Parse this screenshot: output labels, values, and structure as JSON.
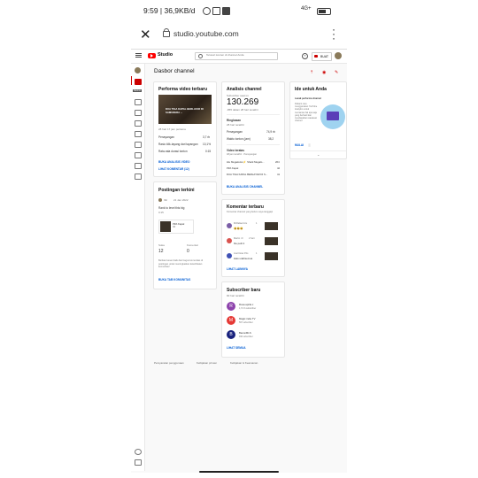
{
  "status_bar": {
    "time_data": "9:59 | 36,9KB/d",
    "signal": "4G+",
    "battery_label": "battery"
  },
  "browser": {
    "url": "studio.youtube.com"
  },
  "topbar": {
    "logo_text": "Studio",
    "search_placeholder": "Telusuri konten di channel Anda",
    "create_label": "BUAT",
    "help_glyph": "?"
  },
  "sidebar": {
    "tooltip": "Dasbor"
  },
  "page": {
    "title": "Dasbor channel"
  },
  "latest_video": {
    "title": "Performa video terbaru",
    "thumb_caption": "DUA TIGA KAPAL BERLAYAR DI SAMUDERA ...",
    "meta": "28 hari 17 jam pertama",
    "rows": [
      {
        "label": "Penayangan",
        "value": "3,7 rb"
      },
      {
        "label": "Rasio klik-tayang dari tayangan",
        "value": "10,1%"
      },
      {
        "label": "Rata-rata durasi tonton",
        "value": "0:15"
      }
    ],
    "link_analysis": "BUKA ANALISIS VIDEO",
    "link_comments": "LIHAT KOMENTAR (12)"
  },
  "latest_post": {
    "title": "Postingan terkini",
    "author": "Ibil",
    "date": "21 Jan 2022",
    "body": "Rank to level this big",
    "sub": "0:15",
    "embed_title": "Pilih Kapal",
    "embed_sub": "Ibil",
    "stats": [
      {
        "label": "Suka",
        "value": "12"
      },
      {
        "label": "Komentar",
        "value": "0"
      }
    ],
    "note": "Berikan kesan baik dan bagus komunitas di postingan untuk meningkatkan keterlibatan komunitas!",
    "link": "BUKA TAB KOMUNITAS"
  },
  "analytics": {
    "title": "Analisis channel",
    "sub_label": "Subscriber saat ini",
    "subscribers": "130.269",
    "sub_change": "-855 dalam 28 hari terakhir",
    "summary_title": "Ringkasan",
    "summary_sub": "28 hari terakhir",
    "summary_rows": [
      {
        "label": "Penayangan",
        "value": "74,9 rb"
      },
      {
        "label": "Waktu tonton (jam)",
        "value": "38,2"
      }
    ],
    "top_title": "Video teratas",
    "top_sub": "48 jam terakhir · Penayangan",
    "top_rows": [
      {
        "label": "Hiu Megalodon⚡ Shark Megalo...",
        "value": "264"
      },
      {
        "label": "Pilih Kapal",
        "value": "42"
      },
      {
        "label": "DUA TIGA KAPAL BERLAYAR DI S...",
        "value": "41"
      }
    ],
    "link": "BUKA ANALISIS CHANNEL"
  },
  "comments": {
    "title": "Komentar terbaru",
    "sub": "Komentar channel yang belum saya tanggapi",
    "items": [
      {
        "name": "MrRafael Aru",
        "time": "1",
        "text": "😆😆😆",
        "color": "#7b5ea7"
      },
      {
        "name": "Martin .D",
        "time": "2 hari",
        "text": "Ibu pelit 2",
        "color": "#d9534f"
      },
      {
        "name": "Joel Dewi Pris",
        "time": "1",
        "text": "Halo udahsemua",
        "color": "#3f51b5"
      }
    ],
    "link": "LIHAT LAINNYA"
  },
  "new_subs": {
    "title": "Subscriber baru",
    "sub": "90 hari terakhir",
    "items": [
      {
        "initial": "R",
        "name": "Rosa aprila c",
        "count": "1,72 rb subscriber",
        "color": "#8e44ad"
      },
      {
        "initial": "M",
        "name": "Magic indie TV",
        "count": "567 subscriber",
        "color": "#e53935"
      },
      {
        "initial": "B",
        "name": "BaconMLS",
        "count": "496 subscriber",
        "color": "#1a237e"
      }
    ],
    "link": "LIHAT SEMUA"
  },
  "ideas": {
    "title": "Ide untuk Anda",
    "label": "Lacak performa channel",
    "body": "Pahami cara menggunakan YouTube Analytics untuk memantau hal apa saja yang berhasil dan mendapatkan wawasan channel",
    "link": "MULAI"
  },
  "footer": {
    "links": [
      "Persyaratan penggunaan",
      "Kebijakan privasi",
      "Kebijakan & Keamanan"
    ]
  }
}
